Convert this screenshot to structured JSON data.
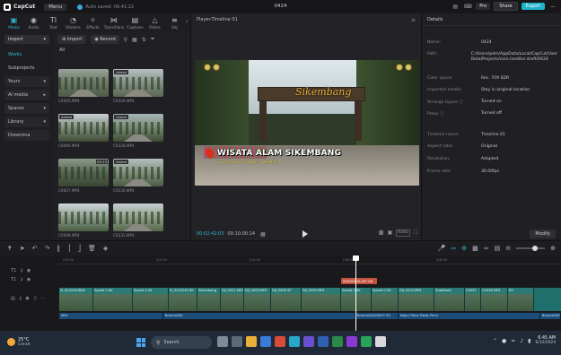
{
  "titlebar": {
    "app_name": "CapCut",
    "menu_label": "Menu",
    "autosave_text": "Auto saved: 06:41:22",
    "project_title": "0424",
    "pro_label": "Pro",
    "share_label": "Share",
    "export_label": "Export"
  },
  "toolbar": {
    "tools": [
      {
        "icon": "▣",
        "label": "Media",
        "active": true
      },
      {
        "icon": "◉",
        "label": "Audio"
      },
      {
        "icon": "TI",
        "label": "Text"
      },
      {
        "icon": "◔",
        "label": "Stickers"
      },
      {
        "icon": "✧",
        "label": "Effects"
      },
      {
        "icon": "⋈",
        "label": "Transitions"
      },
      {
        "icon": "▤",
        "label": "Captions"
      },
      {
        "icon": "△",
        "label": "Filters"
      },
      {
        "icon": "≡",
        "label": "Adj"
      }
    ]
  },
  "leftnav": {
    "import_label": "Import",
    "items": [
      {
        "label": "Works",
        "selected": true
      },
      {
        "label": "Subprojects"
      },
      {
        "label": "Yours",
        "boxed": true,
        "caret": "▾"
      },
      {
        "label": "AI media",
        "boxed": true,
        "caret": "▸"
      },
      {
        "label": "Spaces",
        "boxed": true,
        "caret": "▾"
      },
      {
        "label": "Library",
        "boxed": true,
        "caret": "▾"
      },
      {
        "label": "Dreamina",
        "boxed": true
      }
    ]
  },
  "media": {
    "import_label": "Import",
    "record_label": "Record",
    "all_label": "All",
    "items": [
      {
        "name": "C0005.MP4",
        "badge": "",
        "dur": ""
      },
      {
        "name": "C0226.MP4",
        "badge": "Added",
        "dur": ""
      },
      {
        "name": "C0006.MP4",
        "badge": "Added",
        "dur": ""
      },
      {
        "name": "C0228.MP4",
        "badge": "Added",
        "dur": ""
      },
      {
        "name": "C0007.MP4",
        "badge": "",
        "dur": "00:13"
      },
      {
        "name": "C0230.MP4",
        "badge": "Added",
        "dur": ""
      },
      {
        "name": "C0008.MP4",
        "badge": "",
        "dur": ""
      },
      {
        "name": "C0231.MP4",
        "badge": "",
        "dur": ""
      }
    ]
  },
  "player": {
    "title": "Player-Timeline 01",
    "overlay_title": "WISATA ALAM SIKEMBANG",
    "overlay_sub": "Sukamakmur, Bogor, Jawa Barat",
    "sign_text": "Sikembang",
    "timecode_current": "00:02:42:03",
    "timecode_total": "00:10:00:14",
    "ratio_label": "Ratio"
  },
  "details": {
    "header": "Details",
    "rows": [
      {
        "k": "Name:",
        "v": "0424"
      },
      {
        "k": "Path:",
        "v": "C:/Users/pdm/AppData/Local/CapCut/User Data/Projects/com.lveditor.draft/0424"
      },
      {
        "k": "Color space:",
        "v": "Rec. 709 SDR"
      },
      {
        "k": "Imported media:",
        "v": "Stay in original location"
      },
      {
        "k": "Arrange layers ⓘ",
        "v": "Turned on"
      },
      {
        "k": "Proxy ⓘ",
        "v": "Turned off"
      },
      {
        "k": "Timeline name:",
        "v": "Timeline 01"
      },
      {
        "k": "Aspect ratio:",
        "v": "Original"
      },
      {
        "k": "Resolution:",
        "v": "Adapted"
      },
      {
        "k": "Frame rate:",
        "v": "30.00fps"
      }
    ],
    "modify_label": "Modify"
  },
  "timeline": {
    "ruler": [
      "|00:00",
      "|02:00",
      "|04:00",
      "|06:00",
      "|08:00"
    ],
    "title_clip": "WISATA ALAM SIK",
    "video_clips": [
      {
        "label": "5l_SL20240806",
        "w": 38
      },
      {
        "label": "Speed 0.8X",
        "w": 44
      },
      {
        "label": "Speed 0.9X",
        "w": 40
      },
      {
        "label": "5l_SL20240 80",
        "w": 32
      },
      {
        "label": "Sikembang",
        "w": 26
      },
      {
        "label": "DJI_0007.MP4",
        "w": 26
      },
      {
        "label": "DJI_0009.MP4",
        "w": 30
      },
      {
        "label": "DJI_0008 SP",
        "w": 34
      },
      {
        "label": "DJI_0009.MP4",
        "w": 44
      },
      {
        "label": "Speed 0.9X",
        "w": 34
      },
      {
        "label": "Speed 0.9X",
        "w": 30
      },
      {
        "label": "DJI_0010.MP4",
        "w": 40
      },
      {
        "label": "Stabilized",
        "w": 34
      },
      {
        "label": "C0037",
        "w": 18
      },
      {
        "label": "C0036.MP4",
        "w": 30
      },
      {
        "label": "R0",
        "w": 29
      }
    ],
    "audio_clips": [
      {
        "label": "WSt",
        "w": 116
      },
      {
        "label": "BroncaSAS",
        "w": 214
      },
      {
        "label": "BroncaSAS20097 92",
        "w": 48
      },
      {
        "label": "Natur Films Zakat Perlu",
        "w": 158
      },
      {
        "label": "BroncaSAS",
        "w": 23
      }
    ]
  },
  "taskbar": {
    "temp": "25°C",
    "condition": "Cerah",
    "search_label": "Search",
    "time": "6:45 AM",
    "date": "6/12/2024"
  }
}
